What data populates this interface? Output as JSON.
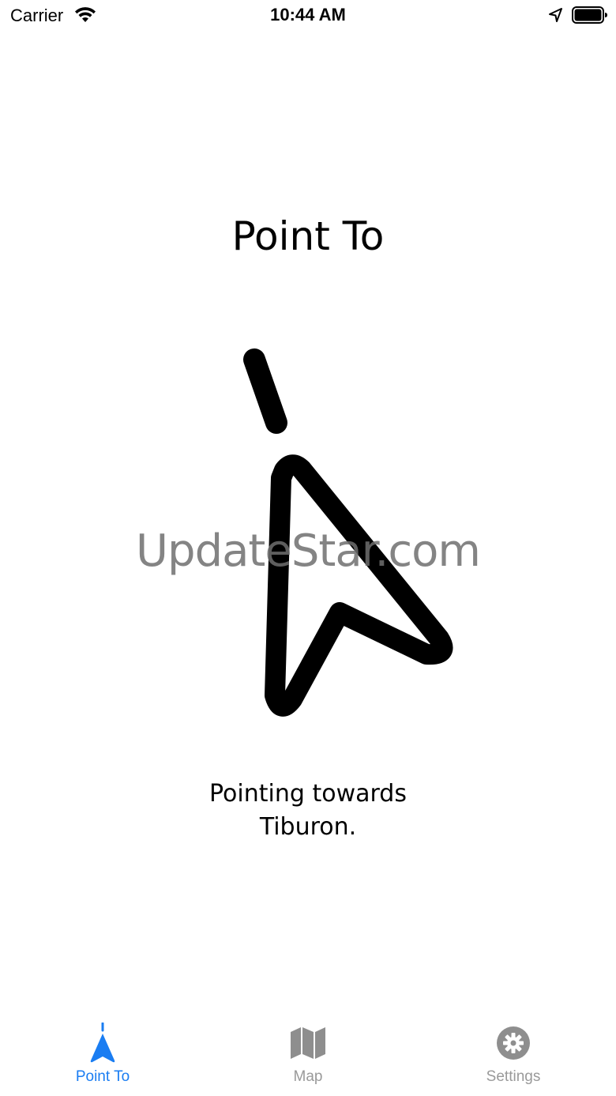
{
  "status_bar": {
    "carrier": "Carrier",
    "time": "10:44 AM",
    "wifi_icon": "wifi-icon",
    "location_icon": "location-arrow-icon",
    "battery_icon": "battery-icon"
  },
  "main": {
    "title": "Point To",
    "pointer_icon": "navigation-pointer-icon",
    "watermark": "UpdateStar.com",
    "status_line_1": "Pointing towards",
    "status_line_2": "Tiburon."
  },
  "tab_bar": {
    "tabs": [
      {
        "label": "Point To",
        "icon": "location-pointer-icon",
        "active": true
      },
      {
        "label": "Map",
        "icon": "map-icon",
        "active": false
      },
      {
        "label": "Settings",
        "icon": "gear-icon",
        "active": false
      }
    ]
  },
  "colors": {
    "accent": "#1a7df2",
    "inactive": "#9a9a9a",
    "foreground": "#000000",
    "background": "#ffffff"
  }
}
